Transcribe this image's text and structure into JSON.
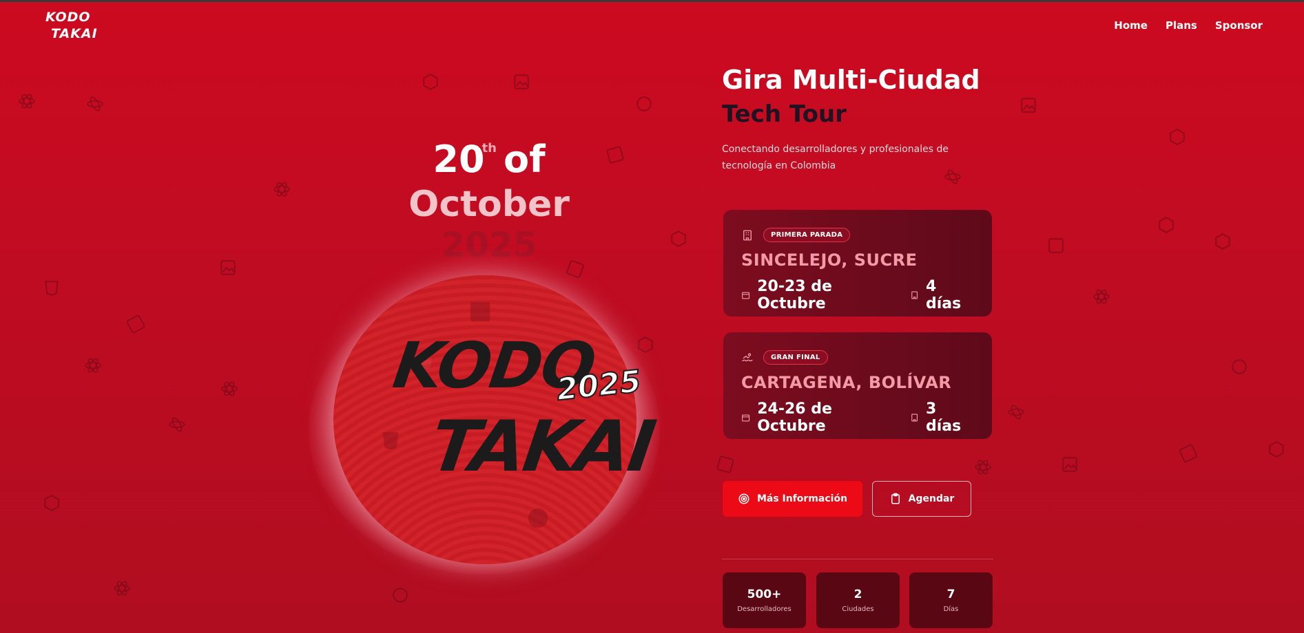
{
  "nav": {
    "logo_line1": "KODO",
    "logo_line2": "TAKAI",
    "items": [
      {
        "label": "Home"
      },
      {
        "label": "Plans"
      },
      {
        "label": "Sponsor"
      }
    ]
  },
  "hero_art": {
    "date_day": "20",
    "date_suffix": "th",
    "date_of": "of",
    "date_month": "October",
    "date_year_ghost": "2025",
    "disc_line1": "KODO",
    "disc_line2": "TAKAI",
    "disc_year": "2025"
  },
  "hero": {
    "title": "Gira Multi-Ciudad",
    "subtitle": "Tech Tour",
    "description": "Conectando desarrolladores y profesionales de tecnología en Colombia"
  },
  "stops": [
    {
      "badge": "PRIMERA PARADA",
      "icon": "building-icon",
      "city": "SINCELEJO, SUCRE",
      "dates": "20-23 de Octubre",
      "duration": "4 días"
    },
    {
      "badge": "GRAN FINAL",
      "icon": "swimmer-icon",
      "city": "CARTAGENA, BOLÍVAR",
      "dates": "24-26 de Octubre",
      "duration": "3 días"
    }
  ],
  "actions": {
    "primary_label": "Más Información",
    "secondary_label": "Agendar"
  },
  "stats": [
    {
      "value": "500+",
      "label": "Desarrolladores"
    },
    {
      "value": "2",
      "label": "Ciudades"
    },
    {
      "value": "7",
      "label": "Días"
    }
  ],
  "colors": {
    "background": "#cc0a20",
    "card": "#6a0b1c",
    "primary_button": "#ec0a16",
    "accent_text": "#f39aa6",
    "stat_bg": "#5a0714"
  }
}
